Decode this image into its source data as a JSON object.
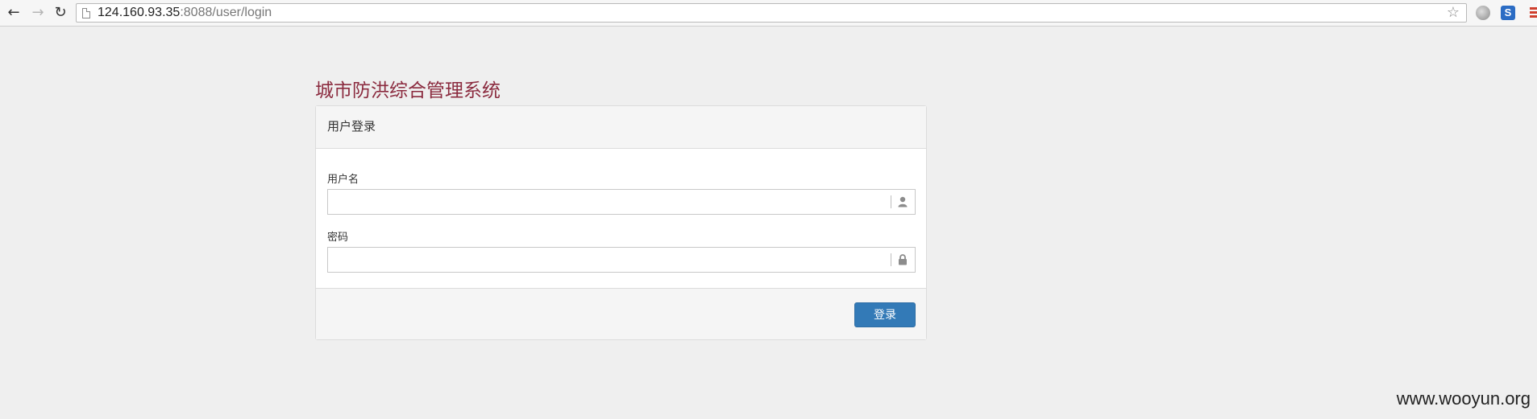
{
  "browser": {
    "back_icon": "←",
    "forward_icon": "→",
    "reload_icon": "↻",
    "url_host": "124.160.93.35",
    "url_rest": ":8088/user/login",
    "star_icon": "☆",
    "ext_s_label": "S"
  },
  "page": {
    "title": "城市防洪综合管理系统",
    "title_color": "#8b2b3f"
  },
  "login": {
    "heading": "用户登录",
    "username_label": "用户名",
    "username_value": "",
    "password_label": "密码",
    "password_value": "",
    "submit_label": "登录",
    "button_color": "#337ab7"
  },
  "watermark": "www.wooyun.org"
}
